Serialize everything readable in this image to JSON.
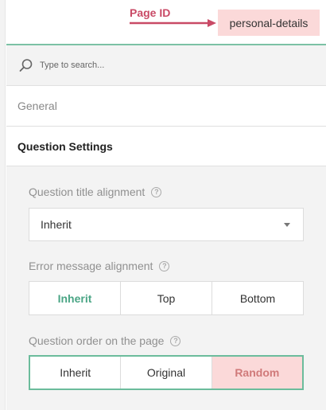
{
  "header": {
    "page_id_label": "Page ID",
    "page_id_value": "personal-details"
  },
  "search": {
    "placeholder": "Type to search..."
  },
  "sections": {
    "general": "General",
    "question_settings": "Question Settings"
  },
  "fields": {
    "title_alignment": {
      "label": "Question title alignment",
      "value": "Inherit"
    },
    "error_alignment": {
      "label": "Error message alignment",
      "options": [
        "Inherit",
        "Top",
        "Bottom"
      ],
      "selected": "Inherit"
    },
    "question_order": {
      "label": "Question order on the page",
      "options": [
        "Inherit",
        "Original",
        "Random"
      ],
      "selected": "Random"
    }
  },
  "colors": {
    "accent_green": "#4aa585",
    "highlight_pink": "#fbd9d9",
    "annotation_pink": "#c94a66"
  }
}
